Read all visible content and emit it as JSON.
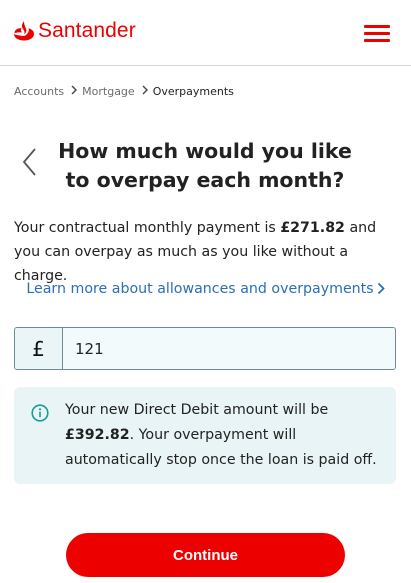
{
  "header": {
    "logo_text": "Santander",
    "brand_color": "#ec0000",
    "menu_icon": "hamburger-menu-icon"
  },
  "breadcrumb": {
    "items": [
      "Accounts",
      "Mortgage",
      "Overpayments"
    ],
    "separator_icon": "chevron-right-icon"
  },
  "page": {
    "back_icon": "chevron-left-icon",
    "title": "How much would you like to overpay each month?"
  },
  "intro": {
    "text_before": "Your contractual monthly payment is ",
    "amount": "£271.82",
    "text_after": " and you can overpay as much as you like without a charge."
  },
  "learn_more": {
    "label": "Learn more about allowances and overpayments",
    "color": "#2b6fb6"
  },
  "amount_field": {
    "currency_symbol": "£",
    "value": "121"
  },
  "info": {
    "icon": "info-icon",
    "text_before": "Your new Direct Debit amount will be ",
    "amount": "£392.82",
    "text_after": ". Your overpayment will automatically stop once the loan is paid off.",
    "background": "#e8f4f5"
  },
  "actions": {
    "continue_label": "Continue"
  }
}
